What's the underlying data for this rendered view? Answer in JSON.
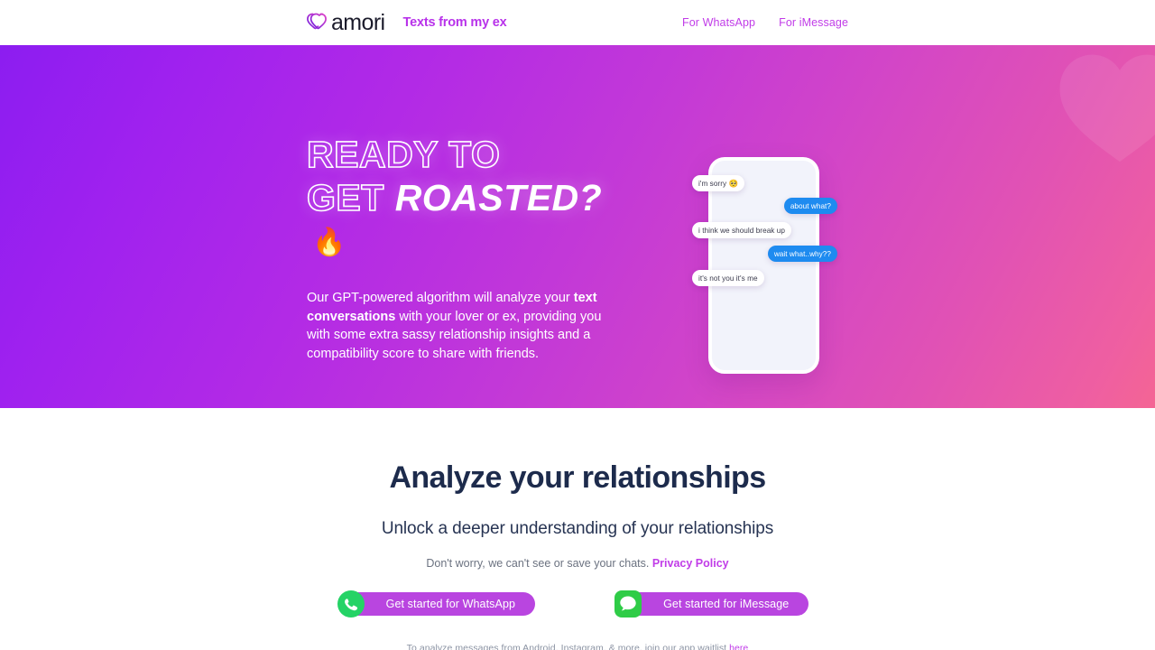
{
  "navbar": {
    "logo_word": "amori",
    "logo_icon": "heart-logo-icon",
    "tagline": "Texts from my ex",
    "links": [
      {
        "label": "For WhatsApp"
      },
      {
        "label": "For iMessage"
      }
    ]
  },
  "hero": {
    "headline_line1": "READY TO",
    "headline_line2_outline": "GET",
    "headline_line2_solid": "ROASTED?",
    "headline_emoji": "🔥",
    "paragraph": {
      "p1": "Our GPT-powered algorithm will analyze your ",
      "bold1": "text conversations",
      "p2": " with your lover or ex, providing you with some extra sassy relationship insights and a compatibility score to share with friends."
    },
    "phone": {
      "messages": [
        {
          "side": "them",
          "text": "i'm sorry ",
          "emoji": "🥺"
        },
        {
          "side": "me",
          "text": "about what?",
          "emoji": ""
        },
        {
          "side": "them",
          "text": "i think we should break up",
          "emoji": ""
        },
        {
          "side": "me",
          "text": "wait what..why??",
          "emoji": ""
        },
        {
          "side": "them",
          "text": "it's not you it's me",
          "emoji": ""
        }
      ]
    }
  },
  "lower": {
    "heading": "Analyze your relationships",
    "subheading": "Unlock a deeper understanding of your relationships",
    "privacy_text": "Don't worry, we can't see or save your chats. ",
    "privacy_link": "Privacy Policy",
    "cta": [
      {
        "label": "Get started for WhatsApp",
        "icon": "whatsapp-icon"
      },
      {
        "label": "Get started for iMessage",
        "icon": "imessage-icon"
      }
    ],
    "footnote_text": "To analyze messages from Android, Instagram, & more, join our app waitlist ",
    "footnote_link": "here"
  },
  "colors": {
    "brand_purple": "#b832ea",
    "nav_link": "#c13ce8",
    "hero_gradient_start": "#8c1df0",
    "hero_gradient_end": "#f46594",
    "heading_navy": "#1d2b4c",
    "bubble_blue": "#1e8bf0",
    "cta_purple": "#b945e0",
    "whatsapp_green": "#25d366",
    "imessage_green": "#2fcc47"
  }
}
